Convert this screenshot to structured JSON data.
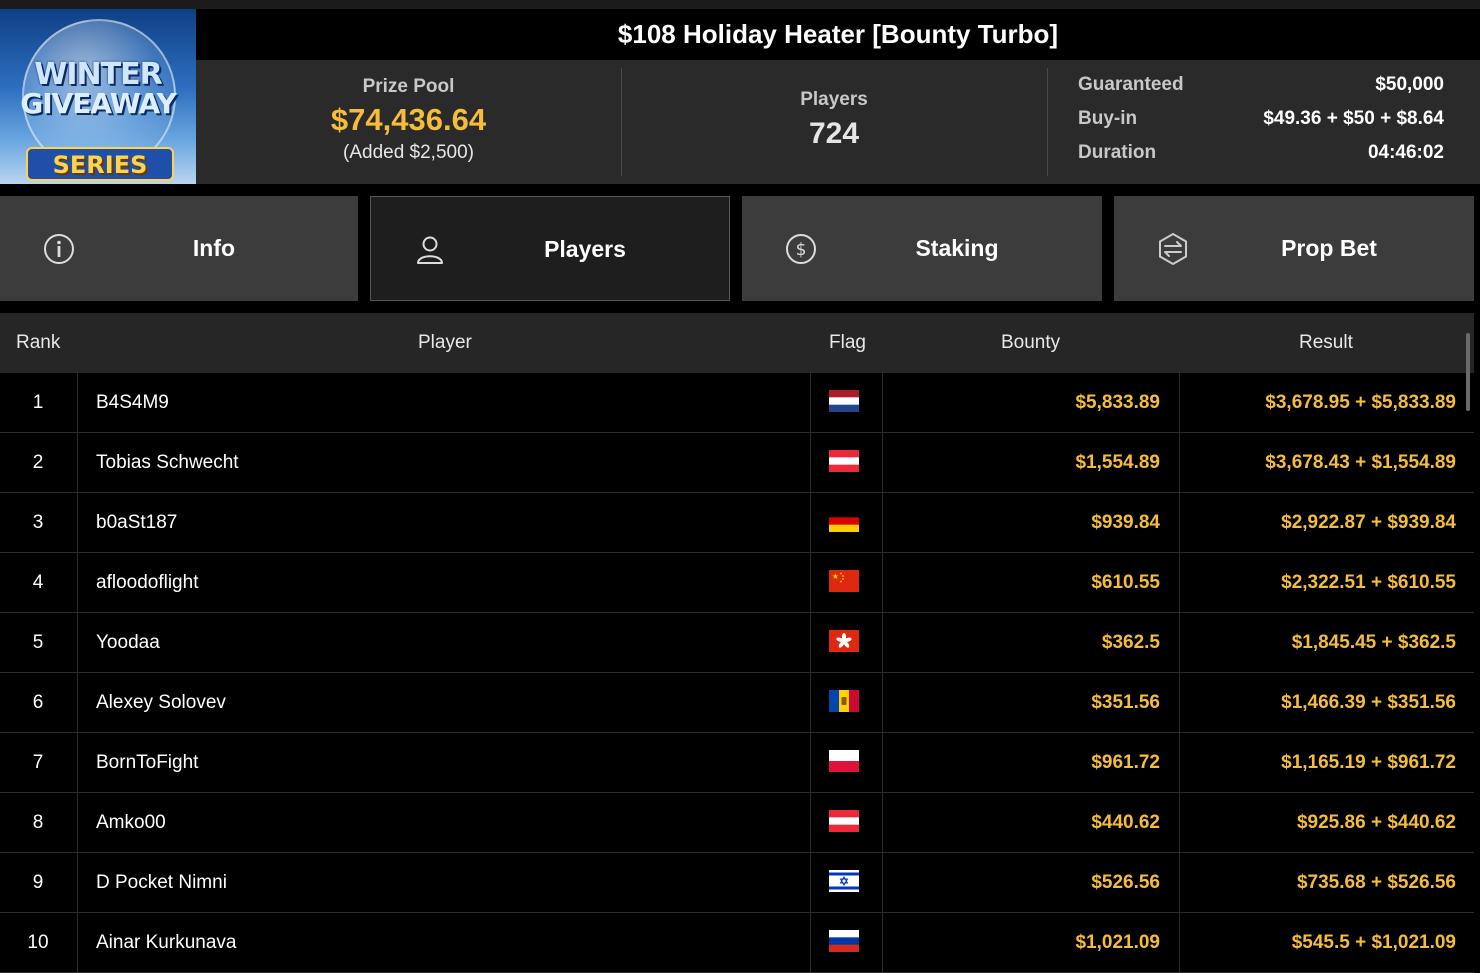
{
  "logo": {
    "line1": "WINTER",
    "line2": "GIVEAWAY",
    "line3": "SERIES"
  },
  "title": "$108 Holiday Heater [Bounty Turbo]",
  "summary": {
    "prize_pool_label": "Prize Pool",
    "prize_pool_value": "$74,436.64",
    "prize_pool_added": "(Added $2,500)",
    "players_label": "Players",
    "players_value": "724",
    "details": [
      {
        "label": "Guaranteed",
        "value": "$50,000"
      },
      {
        "label": "Buy-in",
        "value": "$49.36 + $50 + $8.64"
      },
      {
        "label": "Duration",
        "value": "04:46:02"
      }
    ]
  },
  "tabs": [
    {
      "label": "Info",
      "icon": "info-icon"
    },
    {
      "label": "Players",
      "icon": "user-icon",
      "active": true
    },
    {
      "label": "Staking",
      "icon": "dollar-coin-icon"
    },
    {
      "label": "Prop Bet",
      "icon": "prop-bet-icon"
    }
  ],
  "table": {
    "headers": {
      "rank": "Rank",
      "player": "Player",
      "flag": "Flag",
      "bounty": "Bounty",
      "result": "Result"
    },
    "rows": [
      {
        "rank": "1",
        "player": "B4S4M9",
        "flag": "netherlands",
        "bounty": "$5,833.89",
        "result": "$3,678.95 + $5,833.89"
      },
      {
        "rank": "2",
        "player": "Tobias Schwecht",
        "flag": "austria",
        "bounty": "$1,554.89",
        "result": "$3,678.43 + $1,554.89"
      },
      {
        "rank": "3",
        "player": "b0aSt187",
        "flag": "germany",
        "bounty": "$939.84",
        "result": "$2,922.87 + $939.84"
      },
      {
        "rank": "4",
        "player": "afloodoflight",
        "flag": "china",
        "bounty": "$610.55",
        "result": "$2,322.51 + $610.55"
      },
      {
        "rank": "5",
        "player": "Yoodaa",
        "flag": "hong-kong",
        "bounty": "$362.5",
        "result": "$1,845.45 + $362.5"
      },
      {
        "rank": "6",
        "player": "Alexey Solovev",
        "flag": "moldova",
        "bounty": "$351.56",
        "result": "$1,466.39 + $351.56"
      },
      {
        "rank": "7",
        "player": "BornToFight",
        "flag": "poland",
        "bounty": "$961.72",
        "result": "$1,165.19 + $961.72"
      },
      {
        "rank": "8",
        "player": "Amko00",
        "flag": "austria",
        "bounty": "$440.62",
        "result": "$925.86 + $440.62"
      },
      {
        "rank": "9",
        "player": "D Pocket Nimni",
        "flag": "israel",
        "bounty": "$526.56",
        "result": "$735.68 + $526.56"
      },
      {
        "rank": "10",
        "player": "Ainar Kurkunava",
        "flag": "russia",
        "bounty": "$1,021.09",
        "result": "$545.5 + $1,021.09"
      }
    ]
  },
  "colors": {
    "accent": "#f5bd3a",
    "panel": "#2a2a2a",
    "tab": "#3c3c3c",
    "active_tab": "#1e1e1e"
  }
}
